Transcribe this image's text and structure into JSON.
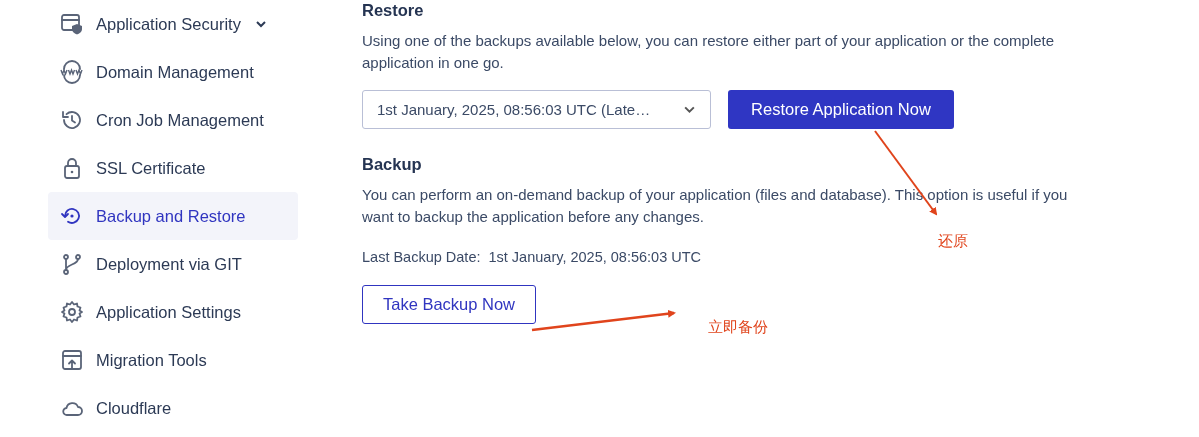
{
  "sidebar": {
    "items": [
      {
        "label": "Application Security",
        "selected": false,
        "expanded": false
      },
      {
        "label": "Domain Management",
        "selected": false
      },
      {
        "label": "Cron Job Management",
        "selected": false
      },
      {
        "label": "SSL Certificate",
        "selected": false
      },
      {
        "label": "Backup and Restore",
        "selected": true
      },
      {
        "label": "Deployment via GIT",
        "selected": false
      },
      {
        "label": "Application Settings",
        "selected": false
      },
      {
        "label": "Migration Tools",
        "selected": false
      },
      {
        "label": "Cloudflare",
        "selected": false
      }
    ]
  },
  "restore": {
    "heading": "Restore",
    "description": "Using one of the backups available below, you can restore either part of your application or the complete application in one go.",
    "backup_select": {
      "value": "1st January, 2025, 08:56:03 UTC (Late…"
    },
    "button": "Restore Application Now"
  },
  "backup": {
    "heading": "Backup",
    "description": "You can perform an on-demand backup of your application (files and database). This option is useful if you want to backup the application before any changes.",
    "last_backup_label": "Last Backup Date:",
    "last_backup_value": "1st January, 2025, 08:56:03 UTC",
    "button": "Take Backup Now"
  },
  "annotations": [
    {
      "text": "还原"
    },
    {
      "text": "立即备份"
    }
  ]
}
